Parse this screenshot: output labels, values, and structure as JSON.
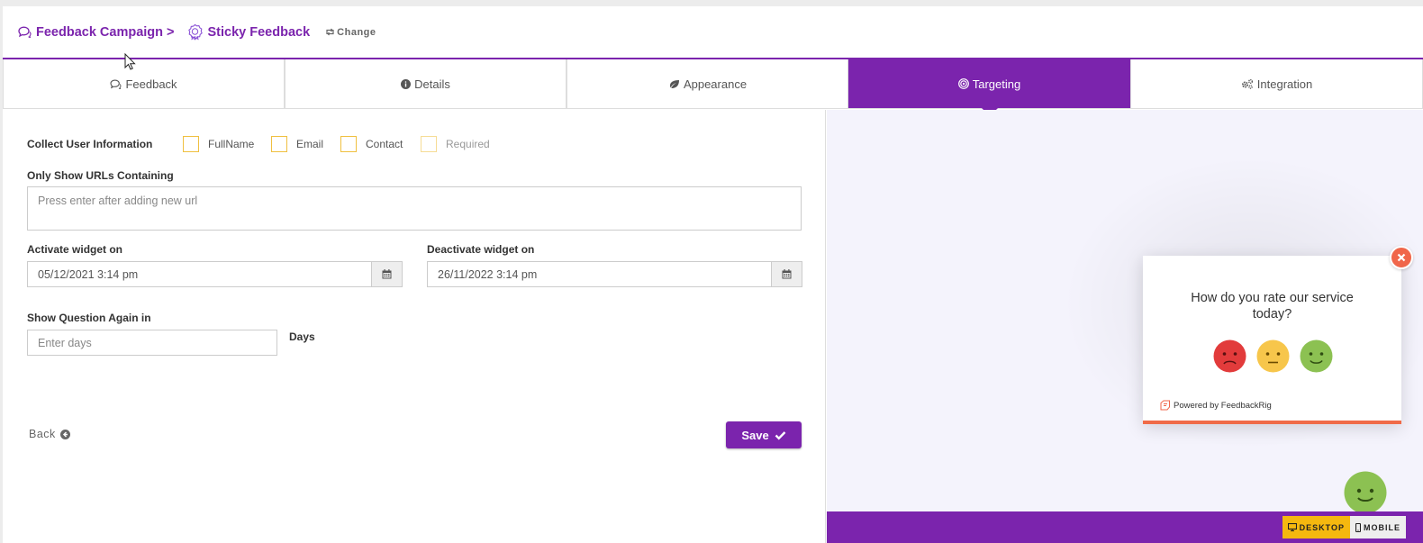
{
  "breadcrumb": {
    "parent": "Feedback Campaign >",
    "current": "Sticky Feedback",
    "change": "Change"
  },
  "tabs": [
    {
      "label": "Feedback",
      "icon": "comments-icon",
      "active": false
    },
    {
      "label": "Details",
      "icon": "info-circle-icon",
      "active": false
    },
    {
      "label": "Appearance",
      "icon": "leaf-icon",
      "active": false
    },
    {
      "label": "Targeting",
      "icon": "bullseye-icon",
      "active": true
    },
    {
      "label": "Integration",
      "icon": "cogs-icon",
      "active": false
    }
  ],
  "form": {
    "collect_label": "Collect User Information",
    "options": [
      "FullName",
      "Email",
      "Contact",
      "Required"
    ],
    "urls_label": "Only Show URLs Containing",
    "urls_placeholder": "Press enter after adding new url",
    "activate_label": "Activate widget on",
    "activate_value": "05/12/2021 3:14 pm",
    "deactivate_label": "Deactivate widget on",
    "deactivate_value": "26/11/2022 3:14 pm",
    "again_label": "Show Question Again in",
    "days_placeholder": "Enter days",
    "days_unit": "Days",
    "back_label": "Back",
    "save_label": "Save"
  },
  "preview": {
    "question": "How do you rate our service today?",
    "powered_by": "Powered by FeedbackRig",
    "faces": [
      "sad-face-icon",
      "neutral-face-icon",
      "happy-face-icon"
    ],
    "desktop_label": "DESKTOP",
    "mobile_label": "MOBILE"
  },
  "colors": {
    "brand": "#7b24ad",
    "checkbox_border": "#f0c040",
    "close": "#f0664a",
    "sad": "#e23b3b",
    "neutral": "#f7c64b",
    "happy": "#8cc152",
    "desktop_btn": "#f5b80f"
  }
}
